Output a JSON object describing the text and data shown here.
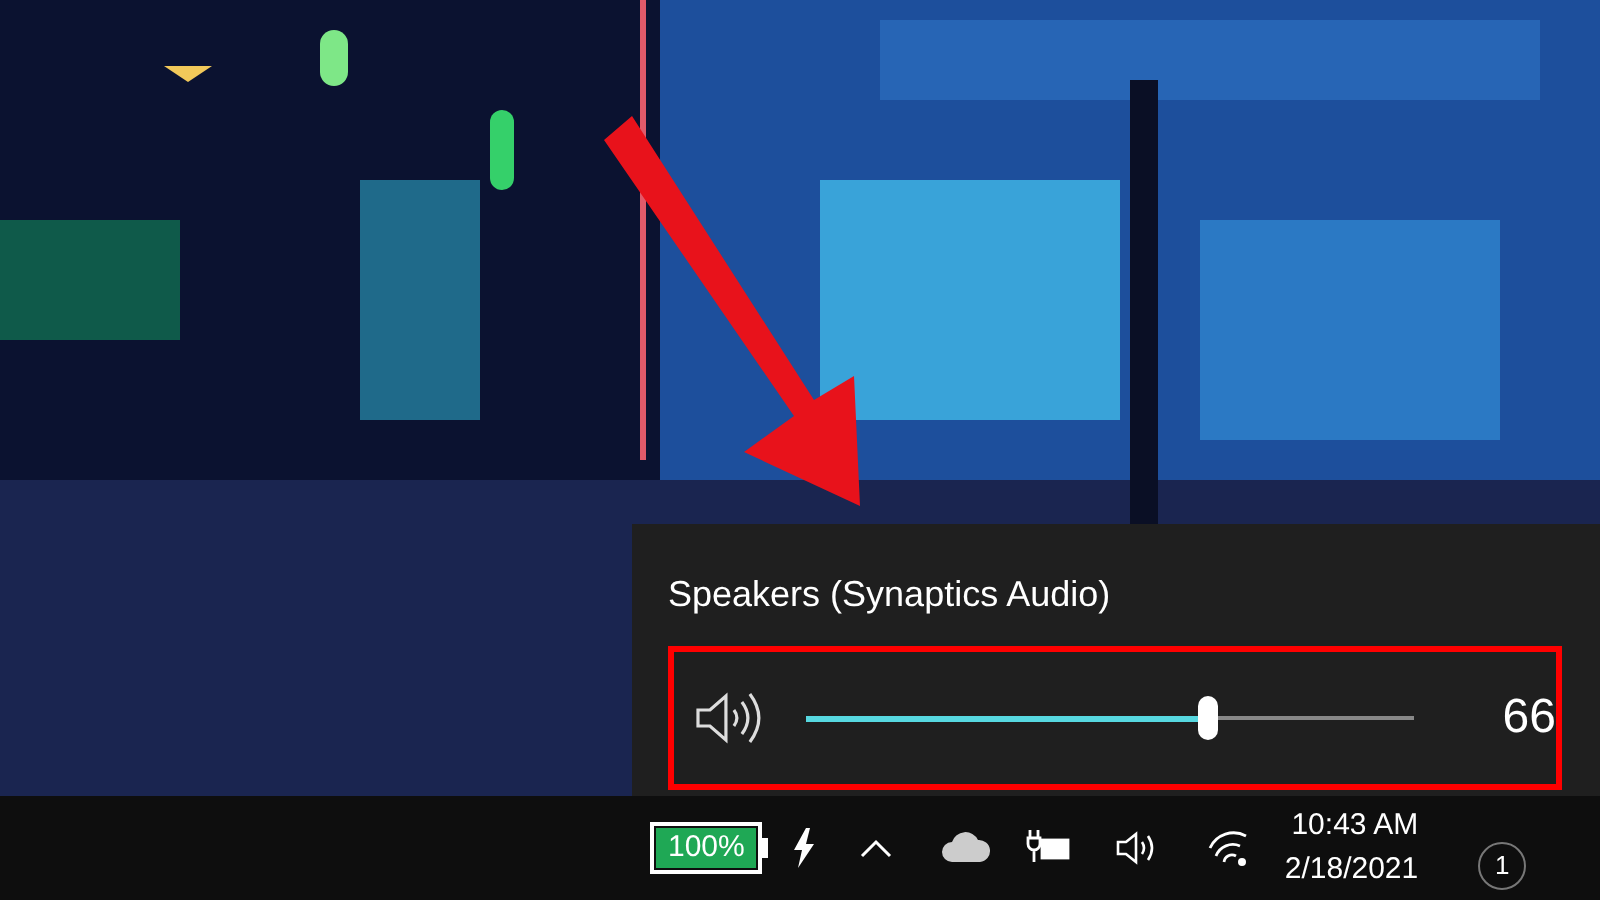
{
  "volume_flyout": {
    "device": "Speakers (Synaptics Audio)",
    "level": 0.66,
    "value": "66"
  },
  "taskbar": {
    "battery": "100%",
    "time": "10:43 AM",
    "date": "2/18/2021",
    "notifications": "1"
  }
}
